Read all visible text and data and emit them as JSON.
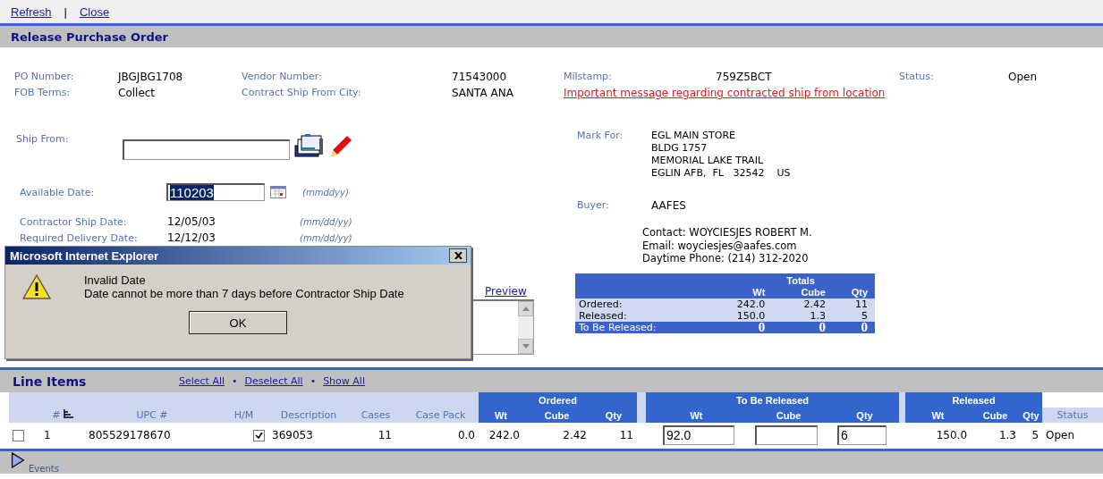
{
  "toolbar": {
    "links": [
      "Refresh",
      "Close"
    ],
    "separator": "|"
  },
  "page_title": "Release Purchase Order",
  "order_info": {
    "rows": [
      [
        {
          "label": "PO Number:",
          "value": "JBGJBG1708"
        },
        {
          "label": "Vendor Number:",
          "value": "71543000"
        },
        {
          "label": "Milstamp:",
          "value": "759Z5BCT"
        },
        {
          "label": "Status:",
          "value": "Open"
        }
      ],
      [
        {
          "label": "FOB Terms:",
          "value": "Collect"
        },
        {
          "label": "Contract Ship From City:",
          "value": "SANTA ANA"
        }
      ]
    ],
    "notice_link": "Important message regarding contracted ship from location"
  },
  "ship_from": {
    "label": "Ship From:"
  },
  "available_date": {
    "label": "Available Date:",
    "value": "110203",
    "highlighted": true,
    "format": "(mmddyy)"
  },
  "dates": [
    {
      "label": "Contractor Ship Date:",
      "value": "12/05/03",
      "format": "(mm/dd/yy)"
    },
    {
      "label": "Required Delivery Date:",
      "value": "12/12/03",
      "format": "(mm/dd/yy)"
    }
  ],
  "notes": {
    "link": "Preview"
  },
  "mark_for": {
    "label": "Mark For:",
    "lines": [
      "EGL MAIN STORE",
      "BLDG 1757",
      "MEMORIAL LAKE TRAIL",
      "EGLIN AFB,  FL   32542    US"
    ]
  },
  "buyer": {
    "label": "Buyer:",
    "value": "AAFES"
  },
  "contact_lines": [
    "Contact: WOYCIESJES ROBERT M.",
    "Email: woyciesjes@aafes.com",
    "Daytime Phone: (214) 312-2020"
  ],
  "totals": {
    "title": "Totals",
    "columns": [
      "Wt",
      "Cube",
      "Qty"
    ],
    "rows": [
      {
        "kind": "detail",
        "label": "Ordered:",
        "values": [
          "242.0",
          "2.42",
          "11"
        ]
      },
      {
        "kind": "detail",
        "label": "Released:",
        "values": [
          "150.0",
          "1.3",
          "5"
        ]
      },
      {
        "kind": "summary",
        "label": "To Be Released:",
        "values": [
          "0",
          "0",
          "0"
        ]
      }
    ]
  },
  "line_items": {
    "title": "Line Items",
    "links": [
      "Select All",
      "Deselect All",
      "Show All"
    ],
    "separator": "•",
    "groups": [
      "Ordered",
      "To Be Released",
      "Released"
    ],
    "columns": [
      "#",
      "UPC #",
      "H/M",
      "Description",
      "Cases",
      "Case Pack",
      "Wt",
      "Cube",
      "Qty",
      "Wt",
      "Cube",
      "Qty",
      "Wt",
      "Cube",
      "Qty",
      "Status"
    ],
    "rows": [
      {
        "selected": false,
        "number": "1",
        "upc": "805529178670",
        "hm": true,
        "description": "369053",
        "cases": "11",
        "case_pack": "0.0",
        "ordered": [
          "242.0",
          "2.42",
          "11"
        ],
        "to_be_released": {
          "wt": "92.0",
          "qty": "6"
        },
        "released": [
          "150.0",
          "1.3",
          "5"
        ],
        "status": "Open"
      }
    ]
  },
  "events": {
    "label": "Events"
  },
  "dialog": {
    "title": "Microsoft Internet Explorer",
    "heading": "Invalid Date",
    "message": "Date cannot be more than 7 days before Contractor Ship Date",
    "button": "OK"
  }
}
